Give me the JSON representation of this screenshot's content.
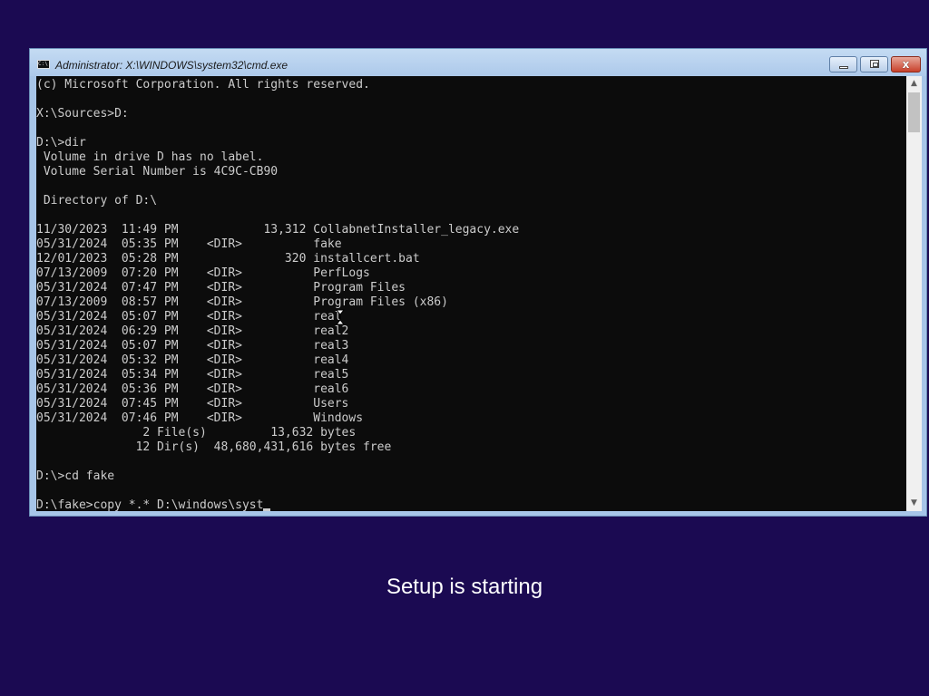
{
  "window": {
    "title": "Administrator: X:\\WINDOWS\\system32\\cmd.exe",
    "icon": "console-app-icon",
    "controls": {
      "minimize": "minimize-icon",
      "maximize": "maximize-icon",
      "close": "close-icon",
      "close_glyph": "x"
    }
  },
  "console": {
    "lines": [
      "(c) Microsoft Corporation. All rights reserved.",
      "",
      "X:\\Sources>D:",
      "",
      "D:\\>dir",
      " Volume in drive D has no label.",
      " Volume Serial Number is 4C9C-CB90",
      "",
      " Directory of D:\\",
      "",
      "11/30/2023  11:49 PM            13,312 CollabnetInstaller_legacy.exe",
      "05/31/2024  05:35 PM    <DIR>          fake",
      "12/01/2023  05:28 PM               320 installcert.bat",
      "07/13/2009  07:20 PM    <DIR>          PerfLogs",
      "05/31/2024  07:47 PM    <DIR>          Program Files",
      "07/13/2009  08:57 PM    <DIR>          Program Files (x86)",
      "05/31/2024  05:07 PM    <DIR>          real",
      "05/31/2024  06:29 PM    <DIR>          real2",
      "05/31/2024  05:07 PM    <DIR>          real3",
      "05/31/2024  05:32 PM    <DIR>          real4",
      "05/31/2024  05:34 PM    <DIR>          real5",
      "05/31/2024  05:36 PM    <DIR>          real6",
      "05/31/2024  07:45 PM    <DIR>          Users",
      "05/31/2024  07:46 PM    <DIR>          Windows",
      "               2 File(s)         13,632 bytes",
      "              12 Dir(s)  48,680,431,616 bytes free",
      "",
      "D:\\>cd fake",
      ""
    ],
    "current_input": "D:\\fake>copy *.* D:\\windows\\syst",
    "colors": {
      "background": "#0c0c0c",
      "foreground": "#cccccc"
    }
  },
  "scrollbar": {
    "up_icon": "scroll-up-arrow-icon",
    "down_icon": "scroll-down-arrow-icon",
    "up_glyph": "▲",
    "down_glyph": "▼"
  },
  "status": {
    "text": "Setup is starting"
  },
  "colors": {
    "desktop_background": "#1b0a52"
  }
}
